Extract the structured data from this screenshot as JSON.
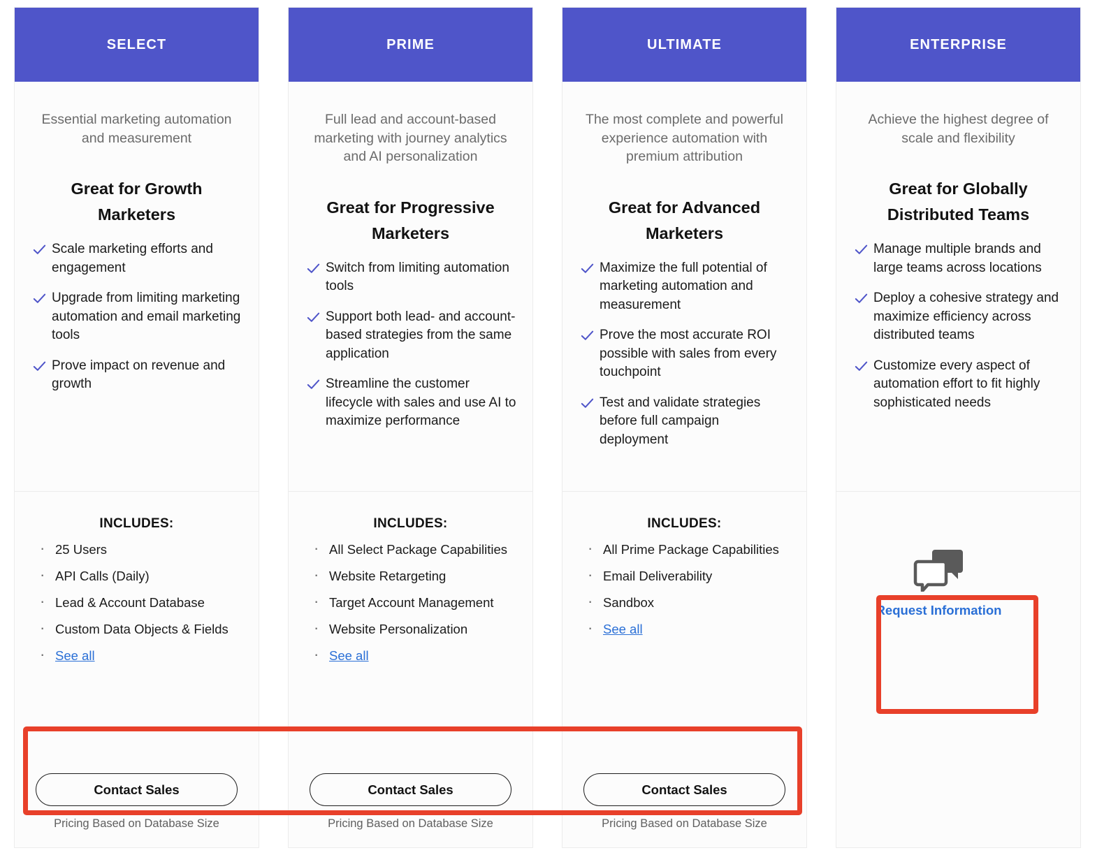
{
  "colors": {
    "header_bg": "#4f55c9",
    "annotation_red": "#e8402a",
    "link_blue": "#2a6fd6",
    "check_purple": "#4f55c9",
    "card_bg": "#fcfcfc"
  },
  "plans": [
    {
      "name": "SELECT",
      "tagline": "Essential marketing automation and measurement",
      "headline": "Great for Growth Marketers",
      "benefits": [
        "Scale marketing efforts and engagement",
        "Upgrade from limiting marketing automation and email marketing tools",
        "Prove impact on revenue and growth"
      ],
      "includes_label": "INCLUDES:",
      "includes": [
        "25 Users",
        "API Calls (Daily)",
        "Lead & Account Database",
        "Custom Data Objects & Fields"
      ],
      "see_all_label": "See all",
      "cta_label": "Contact Sales",
      "price_note": "Pricing Based on Database Size"
    },
    {
      "name": "PRIME",
      "tagline": "Full lead and account-based marketing with journey analytics and AI personalization",
      "headline": "Great for Progressive Marketers",
      "benefits": [
        "Switch from limiting automation tools",
        "Support both lead- and account-based strategies from the same application",
        "Streamline the customer lifecycle with sales and use AI to maximize performance"
      ],
      "includes_label": "INCLUDES:",
      "includes": [
        "All Select Package Capabilities",
        "Website Retargeting",
        "Target Account Management",
        "Website Personalization"
      ],
      "see_all_label": "See all",
      "cta_label": "Contact Sales",
      "price_note": "Pricing Based on Database Size"
    },
    {
      "name": "ULTIMATE",
      "tagline": "The most complete and powerful experience automation with premium attribution",
      "headline": "Great for Advanced Marketers",
      "benefits": [
        "Maximize the full potential of marketing automation and measurement",
        "Prove the most accurate ROI possible with sales from every touchpoint",
        "Test and validate strategies before full campaign deployment"
      ],
      "includes_label": "INCLUDES:",
      "includes": [
        "All Prime Package Capabilities",
        "Email Deliverability",
        "Sandbox"
      ],
      "see_all_label": "See all",
      "cta_label": "Contact Sales",
      "price_note": "Pricing Based on Database Size"
    },
    {
      "name": "ENTERPRISE",
      "tagline": "Achieve the highest degree of scale and flexibility",
      "headline": "Great for Globally Distributed Teams",
      "benefits": [
        "Manage multiple brands and large teams across locations",
        "Deploy a cohesive strategy and maximize efficiency across distributed teams",
        "Customize every aspect of automation effort to fit highly sophisticated needs"
      ],
      "request": {
        "icon": "chat-bubbles-icon",
        "label": "Request Information"
      }
    }
  ],
  "annotations": [
    {
      "name": "contact-sales-row-highlight",
      "shape": "rectangle",
      "color": "#e8402a"
    },
    {
      "name": "request-information-highlight",
      "shape": "rectangle",
      "color": "#e8402a"
    }
  ],
  "icons": {
    "check": "check-icon",
    "bullet": "dot-bullet-icon",
    "chat": "chat-bubbles-icon"
  }
}
